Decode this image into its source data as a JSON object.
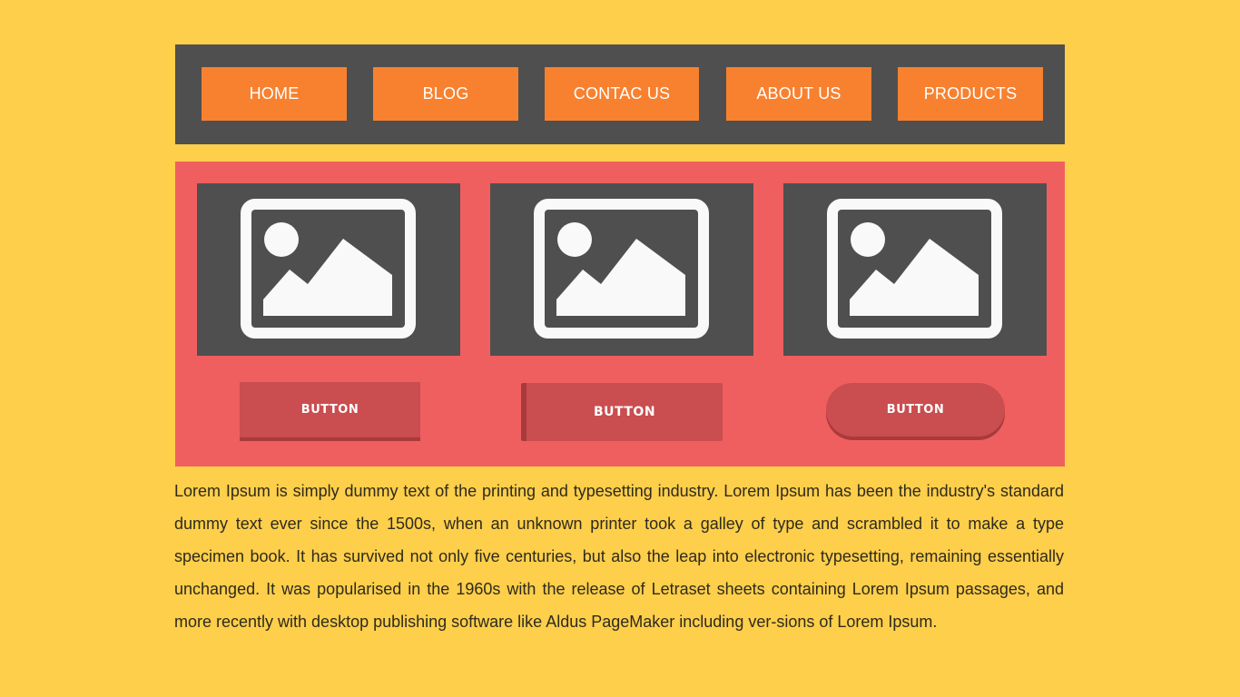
{
  "nav": {
    "items": [
      "HOME",
      "BLOG",
      "CONTAC US",
      "ABOUT US",
      "PRODUCTS"
    ]
  },
  "gallery": {
    "image_icon": "image-placeholder-icon",
    "buttons": [
      "BUTTON",
      "BUTTON",
      "BUTTON"
    ]
  },
  "body_text": "Lorem Ipsum is simply dummy text of the printing and typesetting industry. Lorem Ipsum has been the industry's standard dummy text ever since the 1500s, when an unknown printer took a galley of type and scrambled it to make a type specimen book. It has survived not only five centuries, but also the leap into electronic typesetting, remaining essentially unchanged. It was popularised in the 1960s with the release of Letraset sheets containing Lorem Ipsum passages, and more recently with desktop publishing software like Aldus PageMaker including ver-sions of Lorem Ipsum.",
  "colors": {
    "background": "#FDCF4A",
    "nav_bar": "#4F4F4F",
    "nav_button": "#F8812F",
    "gallery_panel": "#EF5F60",
    "button": "#CA4D4F",
    "button_shadow": "#A93A3C"
  }
}
